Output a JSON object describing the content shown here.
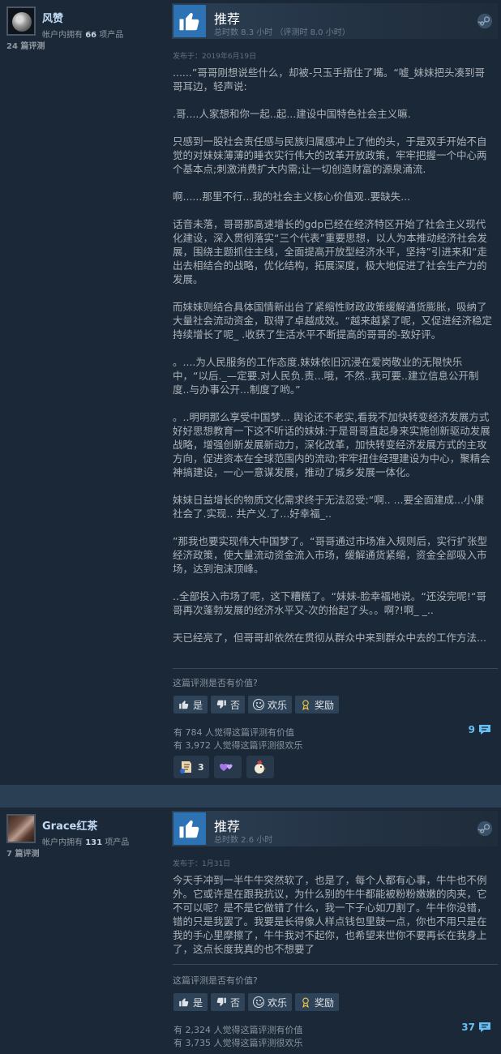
{
  "reviews": [
    {
      "username": "风赞",
      "owned_prefix": "帐户内拥有 ",
      "owned_count": "66",
      "owned_suffix": " 项产品",
      "review_count": "24 篇评测",
      "verdict": "推荐",
      "hours": "总时数 8.3 小时 （评测时 8.0 小时）",
      "posted": "发布于：2019年6月19日",
      "body": "......”哥哥刚想说些什么，却被-只玉手捂住了嘴。“嘘_妹妹把头凑到哥哥耳边，轻声说:\n\n.哥....人家想和你一起..起...建设中国特色社会主义嘛.\n\n只感到一股社会责任感与民族归属感冲上了他的头，于是双手开始不自觉的对妹妹薄薄的睡衣实行伟大的改革开放政策，牢牢把握一个中心两个基本点;刺激消费扩大内需;让一切创造财富的源泉涌流.\n\n啊......那里不行...我的社会主义核心价值观..要缺失...\n\n话音未落，哥哥那高速增长的gdp已经在经济特区开始了社会主义现代化建设，深入贯彻落实“三个代表”重要思想，以人为本推动经济社会发展，围绕主题抓住主线，全面提高开放型经济水平，坚持”引进来和“走出去相结合的战略，优化结构，拓展深度，极大地促进了社会生产力的发展。\n\n而妹妹则结合具体国情新出台了紧缩性财政政策缓解通货膨胀，吸纳了大量社会流动资金，取得了卓越成效。“越来越紧了呢，又促进经济稳定持续增长了呢_ .收获了生活水平不断提高的哥哥的-致好评。\n\n。....为人民服务的工作态度.妹妹依旧沉浸在爱岗敬业的无限快乐中，“以后._—定要.对人民负.责...哦，不然..我可要..建立信息公开制度..与办事公开...制度了哟。”\n\n。..明明那么享受中国梦... 舆论还不老实,看我不加快转变经济发展方式好好思想教育一下这不听话的妹妹:于是哥哥直起身来实施创新驱动发展战略，增强创新发展新动力，深化改革，加快转变经济发展方式的主攻方向，促进资本在全球范围内的流动;牢牢扭住经理建设为中心，聚精会神搞建设，一心一意谋发展，推动了城乡发展一体化。\n\n妹妹日益增长的物质文化需求终于无法忍受:“啊.. ...要全面建成...小康社会了.实现.. 共产义.了...好幸福_..\n\n”那我也要实现伟大中国梦了。“哥哥通过市场准入规则后，实行扩张型经济政策，使大量流动资金流入市场，缓解通货紧缩，资金全部吸入市场，达到泡沫顶峰。\n\n..全部投入市场了呢，这下糟糕了。“妹妹-脸幸福地说。“还没完呢!“哥哥再次蓬勃发展的经济水平又-次的抬起了头。。啊?!啊_ _..\n\n天已经亮了，但哥哥却依然在贯彻从群众中来到群众中去的工作方法...",
      "helpful_question": "这篇评测是否有价值?",
      "btn_yes": "是",
      "btn_no": "否",
      "btn_funny": "欢乐",
      "btn_award": "奖励",
      "helpful_stat": "有 784 人觉得这篇评测有价值",
      "funny_stat": "有 3,972 人觉得这篇评测很欢乐",
      "comment_count": "9",
      "award_count": "3"
    },
    {
      "username": "Grace红茶",
      "owned_prefix": "帐户内拥有 ",
      "owned_count": "131",
      "owned_suffix": " 项产品",
      "review_count": "7 篇评测",
      "verdict": "推荐",
      "hours": "总时数 2.6 小时",
      "posted": "发布于：1月31日",
      "body": "今天手冲到一半牛牛突然软了，也是了，每个人都有心事，牛牛也不例外。它或许是在跟我抗议，为什么别的牛牛都能被粉粉嫩嫩的肉夹，它不可以呢？是不是它做错了什么，我一下子心如刀割了。牛牛你没错，错的只是我罢了。我要是长得像人样点钱包里鼓一点，你也不用只是在我的手心里摩擦了，牛牛我对不起你，也希望来世你不要再长在我身上了，这点长度我真的也不想要了",
      "helpful_question": "这篇评测是否有价值?",
      "btn_yes": "是",
      "btn_no": "否",
      "btn_funny": "欢乐",
      "btn_award": "奖励",
      "helpful_stat": "有 2,324 人觉得这篇评测有价值",
      "funny_stat": "有 3,735 人觉得这篇评测很欢乐",
      "comment_count": "37"
    }
  ]
}
